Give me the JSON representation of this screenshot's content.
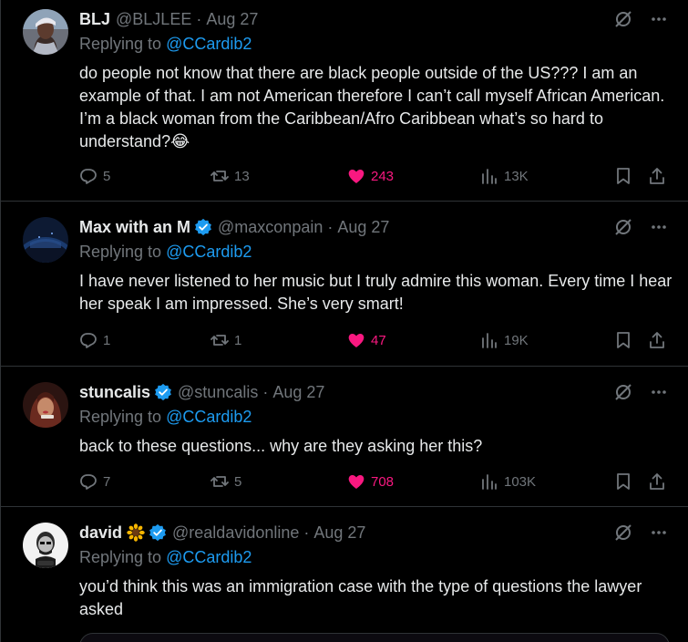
{
  "colors": {
    "background": "#000000",
    "text": "#e7e9ea",
    "muted": "#71767b",
    "link": "#1d9bf0",
    "like": "#f91880",
    "border": "#2f3336"
  },
  "tweets": [
    {
      "name": "BLJ",
      "handle": "@BLJLEE",
      "separator": "·",
      "date": "Aug 27",
      "verified": false,
      "emoji": "",
      "replying_prefix": "Replying to ",
      "replying_to": "@CCardib2",
      "text": "do people not know that there are black people outside of the US??? I am an example of that. I am not American therefore I can’t call myself African American. I’m a black woman from the Caribbean/Afro Caribbean what’s so hard to understand?😂",
      "replies": "5",
      "reposts": "13",
      "likes": "243",
      "views": "13K",
      "liked": true
    },
    {
      "name": "Max with an M",
      "handle": "@maxconpain",
      "separator": "·",
      "date": "Aug 27",
      "verified": true,
      "emoji": "",
      "replying_prefix": "Replying to ",
      "replying_to": "@CCardib2",
      "text": "I have never listened to her music but I truly admire this woman. Every time I hear her speak I am impressed. She’s very smart!",
      "replies": "1",
      "reposts": "1",
      "likes": "47",
      "views": "19K",
      "liked": true
    },
    {
      "name": "stuncalis",
      "handle": "@stuncalis",
      "separator": "·",
      "date": "Aug 27",
      "verified": true,
      "emoji": "",
      "replying_prefix": "Replying to ",
      "replying_to": "@CCardib2",
      "text": "back to these questions... why are they asking her this?",
      "replies": "7",
      "reposts": "5",
      "likes": "708",
      "views": "103K",
      "liked": true
    },
    {
      "name": "david",
      "handle": "@realdavidonline",
      "separator": "·",
      "date": "Aug 27",
      "verified": true,
      "emoji": "sunflower-emoji",
      "replying_prefix": "Replying to ",
      "replying_to": "@CCardib2",
      "text": "you’d think this was an immigration case with the type of questions the lawyer asked",
      "replies": "",
      "reposts": "",
      "likes": "",
      "views": "",
      "liked": false
    }
  ],
  "icons": {
    "grok": "grok-icon",
    "more": "more-icon",
    "reply": "reply-icon",
    "repost": "repost-icon",
    "like": "heart-icon",
    "views": "views-icon",
    "bookmark": "bookmark-icon",
    "share": "share-icon",
    "verified": "verified-badge-icon"
  }
}
